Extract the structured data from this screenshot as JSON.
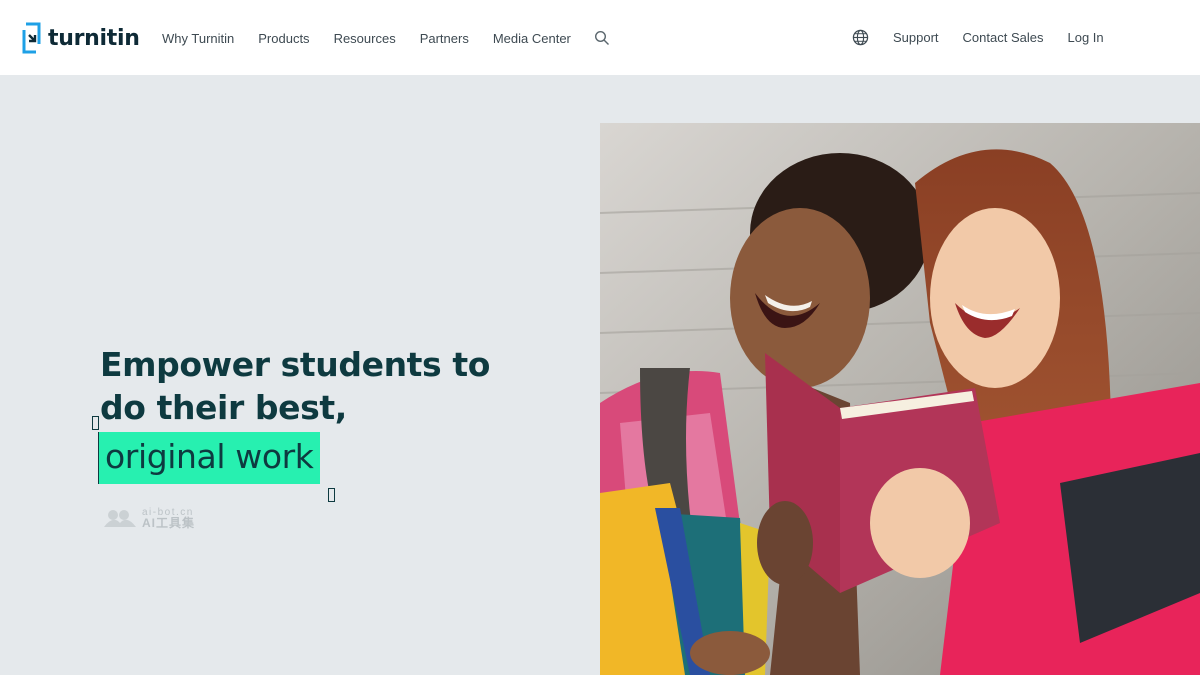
{
  "header": {
    "logo_text": "turnitin",
    "nav": [
      "Why Turnitin",
      "Products",
      "Resources",
      "Partners",
      "Media Center"
    ],
    "right_nav": [
      "Support",
      "Contact Sales",
      "Log In"
    ]
  },
  "hero": {
    "headline_lines": [
      "Empower students to",
      "do their best,"
    ],
    "highlight": "original work",
    "watermark": {
      "top": "ai-bot.cn",
      "bottom": "AI工具集"
    }
  },
  "colors": {
    "accent": "#27f0b0",
    "headline": "#0e3a40",
    "brand_blue": "#1ea0e6",
    "hero_bg": "#e5e9ec"
  }
}
